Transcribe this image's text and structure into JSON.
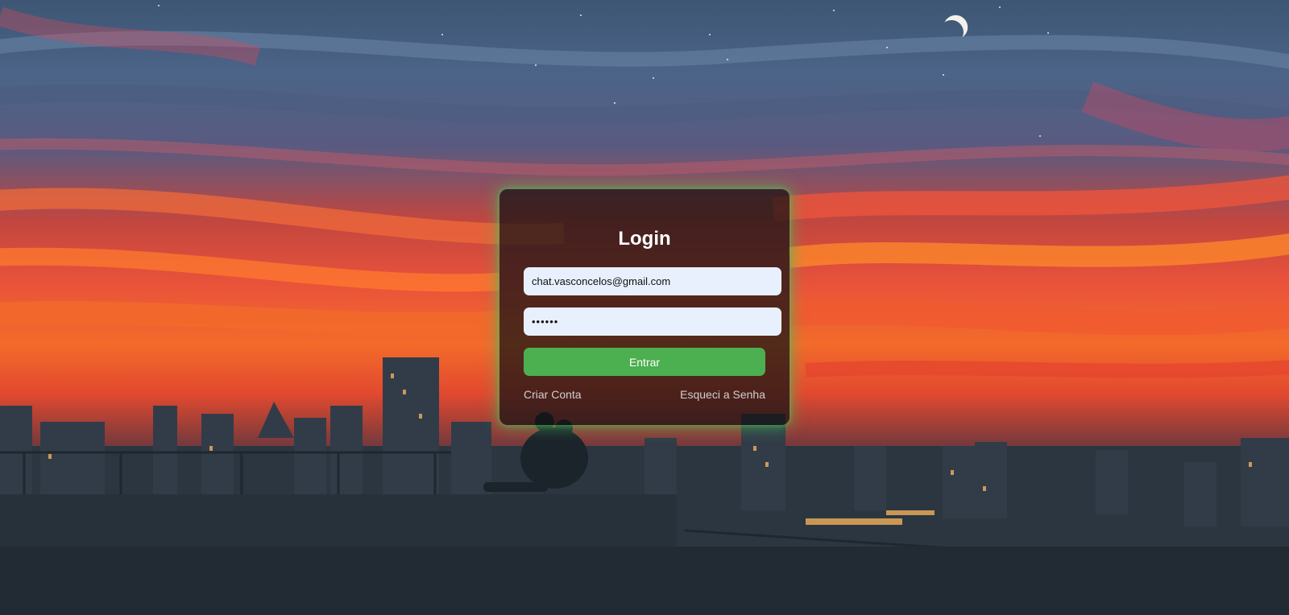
{
  "colors": {
    "accent_green": "#4caf50",
    "input_background": "#e8f0fe",
    "card_background": "rgba(20, 18, 20, 0.72)",
    "link_color": "#cfcfcf"
  },
  "login": {
    "title": "Login",
    "email_value": "chat.vasconcelos@gmail.com",
    "password_value": "••••••",
    "submit_label": "Entrar",
    "create_account_label": "Criar Conta",
    "forgot_password_label": "Esqueci a Senha"
  }
}
